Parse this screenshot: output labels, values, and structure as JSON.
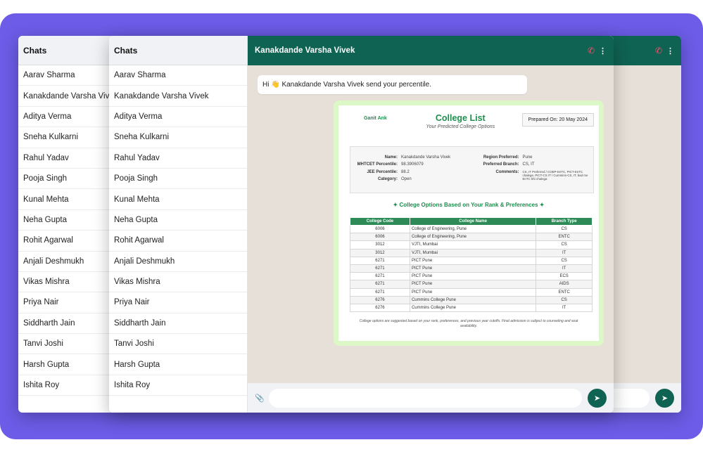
{
  "sidebar": {
    "title": "Chats",
    "chats": [
      "Aarav Sharma",
      "Kanakdande Varsha Vivek",
      "Aditya Verma",
      "Sneha Kulkarni",
      "Rahul Yadav",
      "Pooja Singh",
      "Kunal Mehta",
      "Neha Gupta",
      "Rohit Agarwal",
      "Anjali Deshmukh",
      "Vikas Mishra",
      "Priya Nair",
      "Siddharth Jain",
      "Tanvi Joshi",
      "Harsh Gupta",
      "Ishita Roy"
    ]
  },
  "conversation": {
    "contact_name": "Kanakdande Varsha Vivek",
    "icons": {
      "call": "phone-icon",
      "menu": "kebab-menu-icon",
      "attach": "paperclip-icon",
      "send": "send-icon"
    },
    "incoming_message": "Hi 👋 Kanakdande Varsha Vivek send your percentile.",
    "input_value": "",
    "input_placeholder": ""
  },
  "document": {
    "brand": "Ganit Ank",
    "title": "College List",
    "subtitle": "Your Predicted College Options",
    "prepared_on": "Prepared On: 20 May 2024",
    "details_left": [
      {
        "label": "Name:",
        "value": "Kanakdande Varsha Vivek"
      },
      {
        "label": "MHTCET Percentile:",
        "value": "98.3906079"
      },
      {
        "label": "JEE Percentile:",
        "value": "88.2"
      },
      {
        "label": "Category:",
        "value": "Open"
      }
    ],
    "details_right": [
      {
        "label": "Region Preferred:",
        "value": "Pune"
      },
      {
        "label": "Preferred Branch:",
        "value": "CS, IT"
      },
      {
        "label": "Comments:",
        "value": "CS, IT Preferred / COEP-EnTC, PICT-EnTC chalege, PICT-CS IT / Cummins-CS, IT, bad me EnTC bhi chalega"
      }
    ],
    "section_heading": "✦ College Options Based on Your Rank & Preferences ✦",
    "table": {
      "headers": [
        "College Code",
        "College Name",
        "Branch Type"
      ],
      "rows": [
        [
          "6006",
          "College of Engineering, Pune",
          "CS"
        ],
        [
          "6006",
          "College of Engineering, Pune",
          "ENTC"
        ],
        [
          "3012",
          "VJTI, Mumbai",
          "CS"
        ],
        [
          "3012",
          "VJTI, Mumbai",
          "IT"
        ],
        [
          "6271",
          "PICT Pune",
          "CS"
        ],
        [
          "6271",
          "PICT Pune",
          "IT"
        ],
        [
          "6271",
          "PICT Pune",
          "ECS"
        ],
        [
          "6271",
          "PICT Pune",
          "AIDS"
        ],
        [
          "6271",
          "PICT Pune",
          "ENTC"
        ],
        [
          "6276",
          "Cummins College Pune",
          "CS"
        ],
        [
          "6276",
          "Cummins College Pune",
          "IT"
        ]
      ]
    },
    "footnote": "College options are suggested based on your rank, preferences, and previous year cutoffs. Final admission is subject to counseling and seat availability."
  },
  "colors": {
    "background_accent": "#6c5ce7",
    "header_green": "#0f6353",
    "bubble_green": "#dcf8c6",
    "document_green": "#1e8e4e",
    "call_icon": "#ff4d6d"
  }
}
